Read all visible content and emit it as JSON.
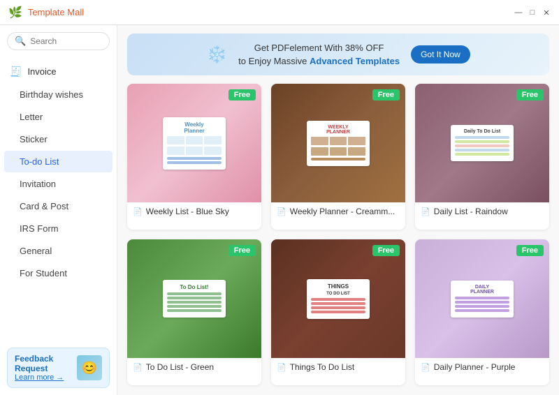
{
  "app": {
    "title": "Template Mall",
    "icon": "🌿"
  },
  "window_controls": {
    "minimize": "—",
    "maximize": "□",
    "close": "✕"
  },
  "sidebar": {
    "search_placeholder": "Search",
    "nav_items": [
      {
        "id": "invoice",
        "label": "Invoice",
        "icon": "🧾",
        "active": false
      },
      {
        "id": "birthday",
        "label": "Birthday wishes",
        "active": false
      },
      {
        "id": "letter",
        "label": "Letter",
        "active": false
      },
      {
        "id": "sticker",
        "label": "Sticker",
        "active": false
      },
      {
        "id": "todo",
        "label": "To-do List",
        "active": true
      },
      {
        "id": "invitation",
        "label": "Invitation",
        "active": false
      },
      {
        "id": "card",
        "label": "Card & Post",
        "active": false
      },
      {
        "id": "irs",
        "label": "IRS Form",
        "active": false
      },
      {
        "id": "general",
        "label": "General",
        "active": false
      },
      {
        "id": "student",
        "label": "For Student",
        "active": false
      }
    ],
    "feedback": {
      "title": "Feedback Request",
      "link": "Learn more →",
      "emoji": "😊"
    }
  },
  "banner": {
    "line1": "Get PDFelement With 38% OFF",
    "line2": "to Enjoy Massive",
    "highlight": "Advanced Templates",
    "btn_label": "Got It Now"
  },
  "templates": [
    {
      "id": 1,
      "title": "Weekly List - Blue Sky",
      "badge": "Free",
      "bg": "bg-pink",
      "type": "weekly"
    },
    {
      "id": 2,
      "title": "Weekly Planner - Creamm...",
      "badge": "Free",
      "bg": "bg-brown",
      "type": "weekly-planner"
    },
    {
      "id": 3,
      "title": "Daily List - Raindow",
      "badge": "Free",
      "bg": "bg-mauve",
      "type": "daily"
    },
    {
      "id": 4,
      "title": "To Do List - Green",
      "badge": "Free",
      "bg": "bg-green",
      "type": "todo"
    },
    {
      "id": 5,
      "title": "Things To Do List",
      "badge": "Free",
      "bg": "bg-darkbrown",
      "type": "things"
    },
    {
      "id": 6,
      "title": "Daily Planner - Purple",
      "badge": "Free",
      "bg": "bg-lightpurple",
      "type": "daily-planner"
    }
  ]
}
